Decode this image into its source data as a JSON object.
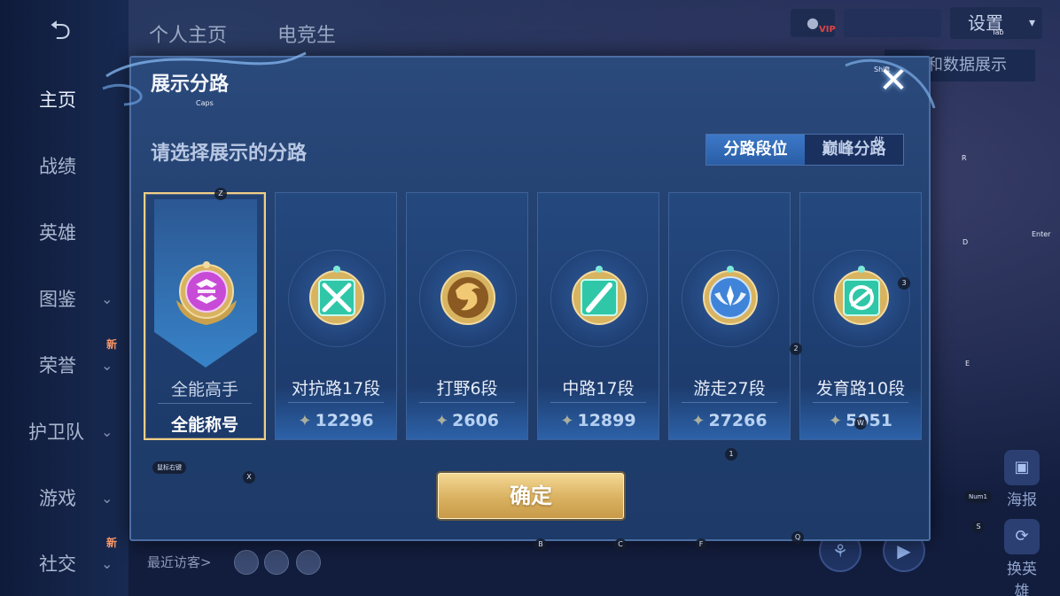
{
  "background": {
    "back_icon": "⮌",
    "top_tabs": [
      "个人主页",
      "电竞生"
    ],
    "settings_label": "设置",
    "settings_chevron": "▾",
    "vip_label": "VIP",
    "right_button_partial": "赛和数据展示",
    "recent_visitors_label": "最近访客>",
    "side_buttons": [
      {
        "label": "海报",
        "icon": "poster-icon"
      },
      {
        "label": "换英雄",
        "icon": "swap-hero-icon"
      }
    ],
    "nav": [
      {
        "label": "主页",
        "active": true,
        "chevron": false
      },
      {
        "label": "战绩",
        "active": false,
        "chevron": false
      },
      {
        "label": "英雄",
        "active": false,
        "chevron": false
      },
      {
        "label": "图鉴",
        "active": false,
        "chevron": true
      },
      {
        "label": "荣誉",
        "active": false,
        "chevron": true,
        "badge": "新"
      },
      {
        "label": "护卫队",
        "active": false,
        "chevron": true
      },
      {
        "label": "游戏",
        "active": false,
        "chevron": true
      },
      {
        "label": "社交",
        "active": false,
        "chevron": true,
        "badge": "新"
      }
    ],
    "chevron_glyph": "⌄"
  },
  "dialog": {
    "title": "展示分路",
    "close_icon": "✕",
    "subtitle": "请选择展示的分路",
    "toggle": {
      "options": [
        "分路段位",
        "巅峰分路"
      ],
      "selected": 0
    },
    "confirm_label": "确定",
    "score_icon": "wheat-leaf-icon",
    "leaf_glyph": "✦",
    "cards": [
      {
        "name": "全能高手",
        "value": "全能称号",
        "selected": true,
        "emblem": "all-round-icon",
        "emblem_color": "#c74bd6"
      },
      {
        "name": "对抗路17段",
        "value": "12296",
        "selected": false,
        "emblem": "clash-lane-icon",
        "emblem_color": "#2fc7a8"
      },
      {
        "name": "打野6段",
        "value": "2606",
        "selected": false,
        "emblem": "jungle-icon",
        "emblem_color": "#d5a050"
      },
      {
        "name": "中路17段",
        "value": "12899",
        "selected": false,
        "emblem": "mid-lane-icon",
        "emblem_color": "#2fc7a8"
      },
      {
        "name": "游走27段",
        "value": "27266",
        "selected": false,
        "emblem": "roam-icon",
        "emblem_color": "#3f84d8"
      },
      {
        "name": "发育路10段",
        "value": "5051",
        "selected": false,
        "emblem": "farm-lane-icon",
        "emblem_color": "#2fc7a8"
      }
    ]
  },
  "key_hints": {
    "caps": "Caps",
    "shift": "Shift",
    "alt": "Alt",
    "tab": "Tab",
    "enter": "Enter",
    "r": "R",
    "d": "D",
    "e": "E",
    "num3": "3",
    "num2": "2",
    "num1": "1",
    "z": "Z",
    "x": "X",
    "w": "W",
    "b": "B",
    "c": "C",
    "f": "F",
    "q": "Q",
    "s": "S",
    "num1pad": "Num1",
    "mouse": "鼠标右键"
  },
  "colors": {
    "accent_gold": "#f0cf86",
    "toggle_active": "#3c78c8",
    "dialog_bg": "#22406f"
  }
}
